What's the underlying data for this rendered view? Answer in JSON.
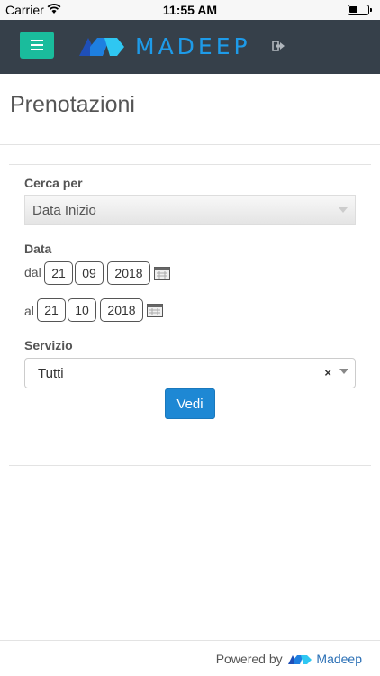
{
  "status_bar": {
    "carrier": "Carrier",
    "time": "11:55 AM"
  },
  "navbar": {
    "logo_text": "MADEEP"
  },
  "page": {
    "title": "Prenotazioni"
  },
  "form": {
    "cerca_per": {
      "label": "Cerca per",
      "selected": "Data Inizio"
    },
    "data": {
      "label": "Data",
      "dal": {
        "label": "dal",
        "day": "21",
        "month": "09",
        "year": "2018"
      },
      "al": {
        "label": "al",
        "day": "21",
        "month": "10",
        "year": "2018"
      }
    },
    "servizio": {
      "label": "Servizio",
      "selected": "Tutti",
      "clear": "×"
    },
    "submit_label": "Vedi"
  },
  "footer": {
    "powered_by": "Powered by",
    "brand": "Madeep"
  },
  "colors": {
    "navbar": "#36404a",
    "menu_button": "#1abc9c",
    "logo": "#1e9be9",
    "primary_button": "#1e88d4"
  }
}
